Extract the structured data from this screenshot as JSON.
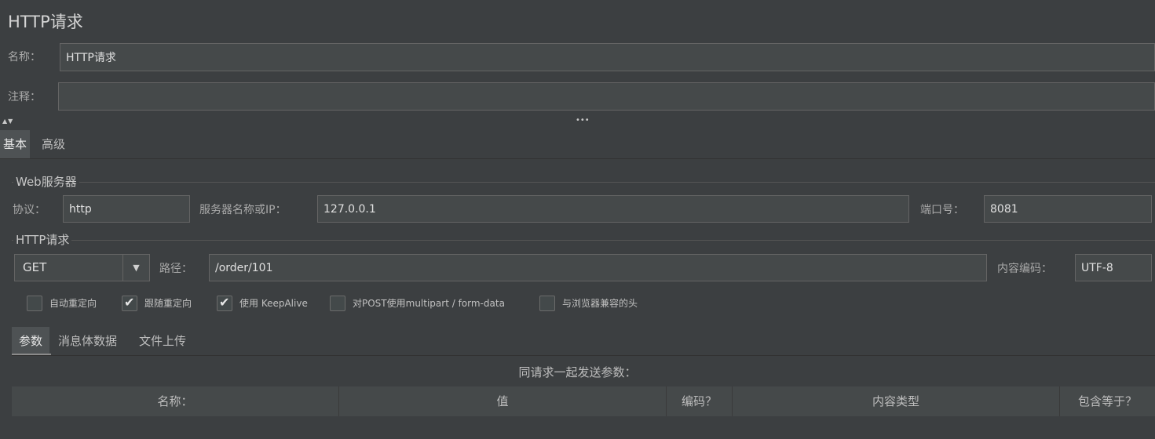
{
  "panel": {
    "title": "HTTP请求"
  },
  "name_field": {
    "label": "名称：",
    "value": "HTTP请求"
  },
  "comment_field": {
    "label": "注释：",
    "value": ""
  },
  "splitter": {
    "arrows": "▲▼",
    "grip": "•••"
  },
  "main_tabs": [
    {
      "label": "基本",
      "active": true
    },
    {
      "label": "高级",
      "active": false
    }
  ],
  "web_server": {
    "section_title": "Web服务器",
    "protocol_label": "协议：",
    "protocol_value": "http",
    "server_label": "服务器名称或IP：",
    "server_value": "127.0.0.1",
    "port_label": "端口号：",
    "port_value": "8081"
  },
  "http_request": {
    "section_title": "HTTP请求",
    "method": "GET",
    "dropdown_arrow": "▼",
    "path_label": "路径：",
    "path_value": "/order/101",
    "encoding_label": "内容编码：",
    "encoding_value": "UTF-8",
    "checkboxes": [
      {
        "label": "自动重定向",
        "checked": false
      },
      {
        "label": "跟随重定向",
        "checked": true
      },
      {
        "label": "使用 KeepAlive",
        "checked": true
      },
      {
        "label": "对POST使用multipart / form-data",
        "checked": false
      },
      {
        "label": "与浏览器兼容的头",
        "checked": false
      }
    ],
    "check_glyph": "✔"
  },
  "sub_tabs": [
    {
      "label": "参数",
      "active": true
    },
    {
      "label": "消息体数据",
      "active": false
    },
    {
      "label": "文件上传",
      "active": false
    }
  ],
  "params": {
    "caption": "同请求一起发送参数：",
    "columns": [
      "名称：",
      "值",
      "编码？",
      "内容类型",
      "包含等于？"
    ]
  }
}
